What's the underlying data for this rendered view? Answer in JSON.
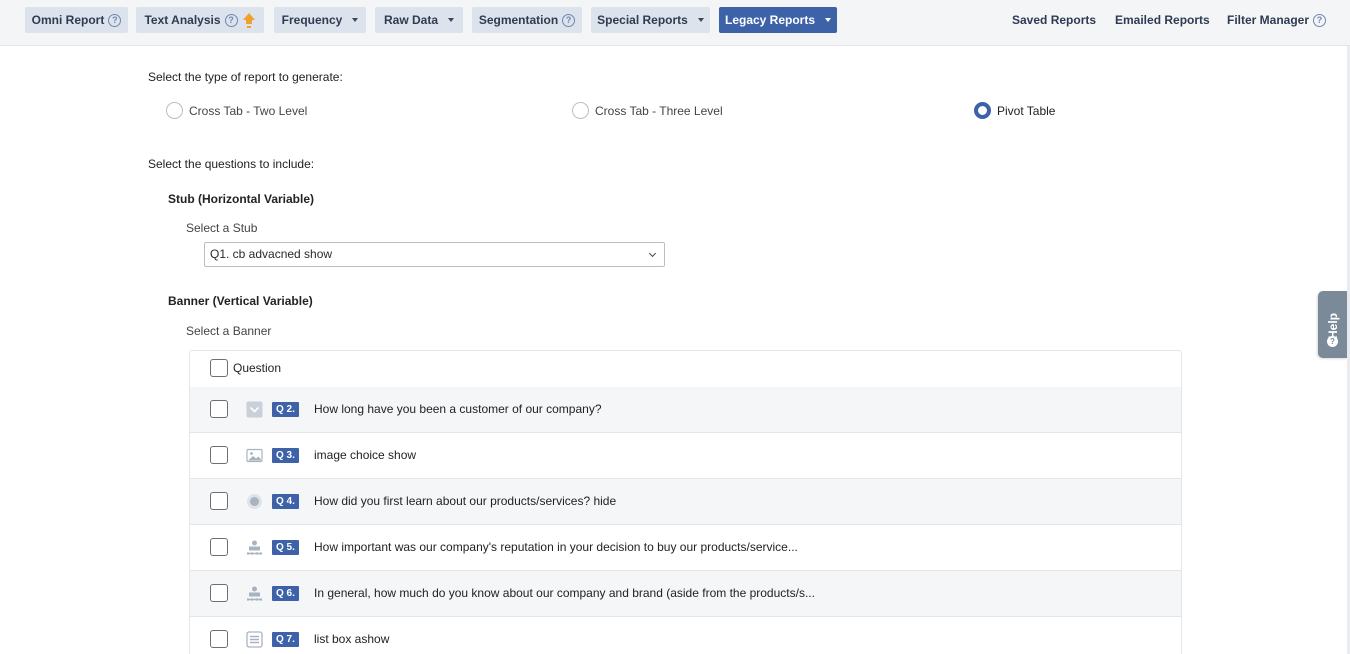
{
  "nav": {
    "omni_report": "Omni Report",
    "text_analysis": "Text Analysis",
    "frequency": "Frequency",
    "raw_data": "Raw Data",
    "segmentation": "Segmentation",
    "special_reports": "Special Reports",
    "legacy_reports": "Legacy Reports",
    "saved_reports": "Saved Reports",
    "emailed_reports": "Emailed Reports",
    "filter_manager": "Filter Manager",
    "help_glyph": "?"
  },
  "report_type": {
    "heading": "Select the type of report to generate:",
    "options": [
      {
        "label": "Cross Tab - Two Level",
        "selected": false
      },
      {
        "label": "Cross Tab - Three Level",
        "selected": false
      },
      {
        "label": "Pivot Table",
        "selected": true
      }
    ]
  },
  "questions": {
    "heading": "Select the questions to include:",
    "stub": {
      "title": "Stub (Horizontal Variable)",
      "select_label": "Select a Stub",
      "selected_value": "Q1. cb advacned show"
    },
    "banner": {
      "title": "Banner (Vertical Variable)",
      "select_label": "Select a Banner",
      "header": "Question",
      "rows": [
        {
          "num": "Q 2.",
          "icon": "dropdown-icon",
          "text": "How long have you been a customer of our company?"
        },
        {
          "num": "Q 3.",
          "icon": "image-icon",
          "text": "image choice show"
        },
        {
          "num": "Q 4.",
          "icon": "radio-icon",
          "text": "How did you first learn about our products/services? hide"
        },
        {
          "num": "Q 5.",
          "icon": "rating-scale-icon",
          "text": "How important was our company's reputation in your decision to buy our products/service..."
        },
        {
          "num": "Q 6.",
          "icon": "rating-scale-icon",
          "text": "In general, how much do you know about our company and brand (aside from the products/s..."
        },
        {
          "num": "Q 7.",
          "icon": "list-box-icon",
          "text": "list box ashow"
        }
      ]
    }
  },
  "help_tab": {
    "label": "Help",
    "glyph": "?"
  },
  "colors": {
    "accent": "#3d62a8",
    "nav_bg": "#dde3ec",
    "row_alt": "#f5f6f8"
  }
}
